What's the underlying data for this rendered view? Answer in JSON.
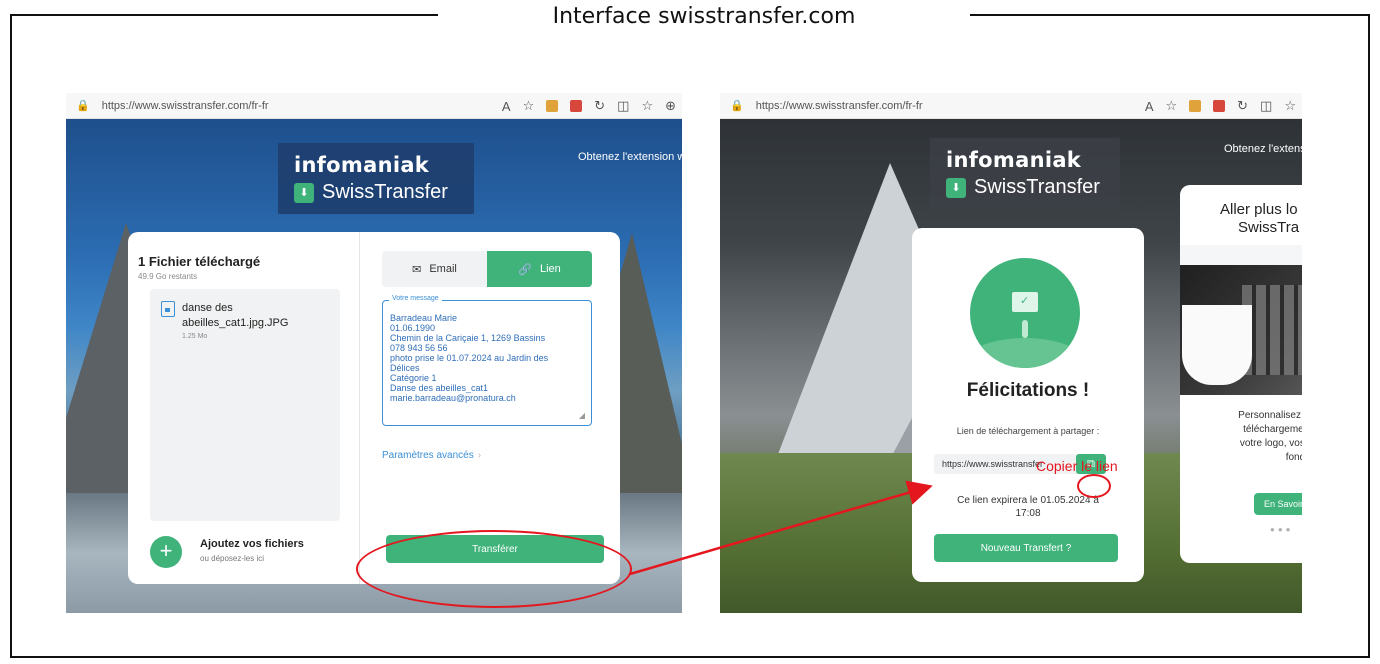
{
  "figure": {
    "title": "Interface swisstransfer.com"
  },
  "left_screen": {
    "url": "https://www.swisstransfer.com/fr-fr",
    "extension_text": "Obtenez l'extension w",
    "logo": {
      "brand": "infomaniak",
      "product": "SwissTransfer"
    },
    "upload": {
      "title": "1 Fichier téléchargé",
      "remaining": "49.9 Go restants",
      "file_name": "danse des abeilles_cat1.jpg.JPG",
      "file_size": "1.25 Mo",
      "add_title": "Ajoutez vos fichiers",
      "add_subtitle": "ou déposez-les ici"
    },
    "tabs": {
      "email": "Email",
      "link": "Lien",
      "selected": "Lien"
    },
    "message": {
      "label": "Votre message",
      "lines": [
        "Barradeau Marie",
        "01.06.1990",
        "Chemin de la Cariçaie 1, 1269 Bassins",
        "078 943 56 56",
        "photo prise le 01.07.2024 au Jardin des",
        "Délices",
        "Catégorie 1",
        "Danse des abeilles_cat1",
        "marie.barradeau@pronatura.ch"
      ]
    },
    "advanced_link": "Paramètres avancés",
    "transfer_button": "Transférer"
  },
  "right_screen": {
    "url": "https://www.swisstransfer.com/fr-fr",
    "extension_text": "Obtenez l'extens",
    "logo": {
      "brand": "infomaniak",
      "product": "SwissTransfer"
    },
    "success": {
      "title": "Félicitations !",
      "share_label": "Lien de téléchargement à partager :",
      "link_value": "https://www.swisstransfer",
      "expire_prefix": "Ce lien expirera le",
      "expire_date": "01.05.2024",
      "expire_suffix": "à",
      "expire_time": "17:08",
      "new_transfer_button": "Nouveau Transfert ?"
    },
    "promo": {
      "title_line1": "Aller plus lo",
      "title_line2": "SwissTra",
      "text_line1": "Personnalisez votre",
      "text_line2": "téléchargement de",
      "text_line3": "votre logo, vos coul",
      "text_line4": "fond d'éc",
      "button": "En Savoir"
    }
  },
  "annotations": {
    "copy_label": "Copier le lien",
    "color": "#e4171f"
  },
  "colors": {
    "accent_green": "#3fb37a",
    "link_blue": "#3a8fd6"
  }
}
